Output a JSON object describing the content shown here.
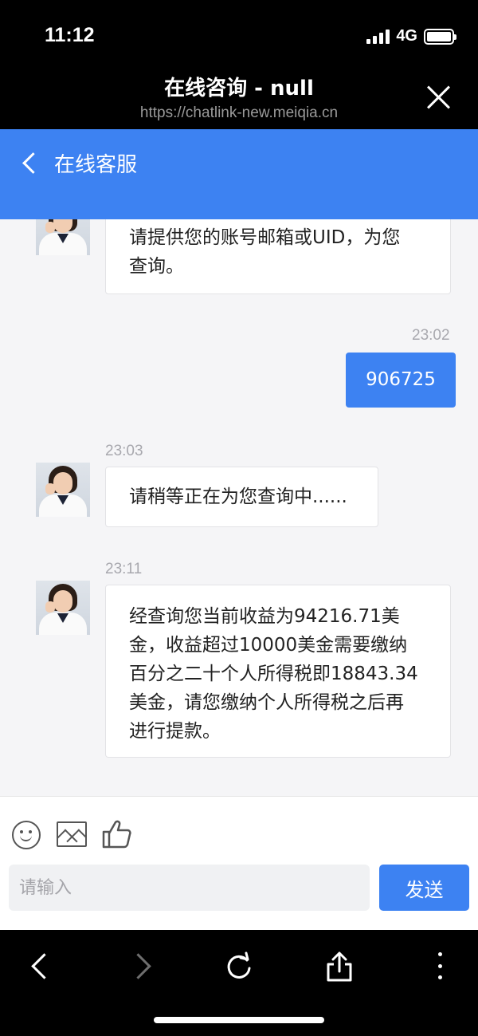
{
  "status_bar": {
    "time": "11:12",
    "network": "4G"
  },
  "browser": {
    "title": "在线咨询 - null",
    "url": "https://chatlink-new.meiqia.cn"
  },
  "app_header": {
    "title": "在线客服"
  },
  "messages": [
    {
      "from": "agent",
      "text_lines": [
        "请提供您的账号邮箱或UID，为您",
        "查询。"
      ]
    },
    {
      "from": "user",
      "time": "23:02",
      "text": "906725"
    },
    {
      "from": "agent",
      "time": "23:03",
      "text_lines": [
        "请稍等正在为您查询中......"
      ]
    },
    {
      "from": "agent",
      "time": "23:11",
      "text_lines": [
        "经查询您当前收益为94216.71美",
        "金，收益超过10000美金需要缴纳",
        "百分之二十个人所得税即18843.34",
        "美金，请您缴纳个人所得税之后再",
        "进行提款。"
      ]
    }
  ],
  "composer": {
    "placeholder": "请输入",
    "send_label": "发送"
  },
  "icons": {
    "toolbar": [
      "emoji-icon",
      "image-icon",
      "thumbs-up-icon"
    ],
    "bottom_nav": [
      "back-icon",
      "forward-icon",
      "refresh-icon",
      "share-icon",
      "more-icon"
    ]
  },
  "colors": {
    "accent": "#3d82f2",
    "chat_background": "#f5f5f7"
  }
}
